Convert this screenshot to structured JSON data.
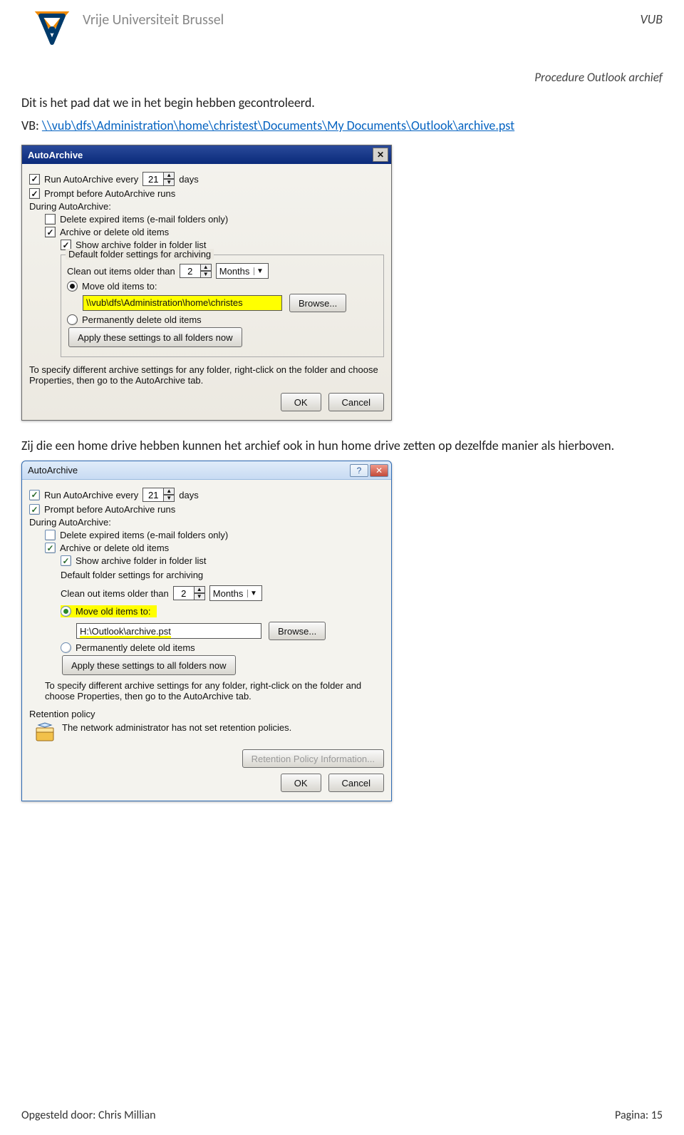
{
  "header": {
    "university": "Vrije Universiteit Brussel",
    "vub": "VUB",
    "subtitle": "Procedure Outlook archief"
  },
  "para1": "Dit is het pad dat we in het begin hebben gecontroleerd.",
  "vb_prefix": "VB: ",
  "vb_path": "\\\\vub\\dfs\\Administration\\home\\christest\\Documents\\My Documents\\Outlook\\archive.pst",
  "dlg1": {
    "title": "AutoArchive",
    "run_label": "Run AutoArchive every",
    "run_value": "21",
    "run_unit": "days",
    "prompt": "Prompt before AutoArchive runs",
    "during": "During AutoArchive:",
    "delete_expired": "Delete expired items (e-mail folders only)",
    "archive_old": "Archive or delete old items",
    "show_folder": "Show archive folder in folder list",
    "fieldset_legend": "Default folder settings for archiving",
    "clean_label": "Clean out items older than",
    "clean_value": "2",
    "clean_unit": "Months",
    "move_label": "Move old items to:",
    "move_path": "\\\\vub\\dfs\\Administration\\home\\christes",
    "browse": "Browse...",
    "perm_delete": "Permanently delete old items",
    "apply_all": "Apply these settings to all folders now",
    "info": "To specify different archive settings for any folder, right-click on the folder and choose Properties, then go to the AutoArchive tab.",
    "ok": "OK",
    "cancel": "Cancel"
  },
  "para2": "Zij die een home drive hebben kunnen het archief ook in hun home drive zetten op dezelfde manier als hierboven.",
  "dlg2": {
    "title": "AutoArchive",
    "run_label": "Run AutoArchive every",
    "run_value": "21",
    "run_unit": "days",
    "prompt": "Prompt before AutoArchive runs",
    "during": "During AutoArchive:",
    "delete_expired": "Delete expired items (e-mail folders only)",
    "archive_old": "Archive or delete old items",
    "show_folder": "Show archive folder in folder list",
    "fieldset_legend": "Default folder settings for archiving",
    "clean_label": "Clean out items older than",
    "clean_value": "2",
    "clean_unit": "Months",
    "move_label": "Move old items to:",
    "move_path": "H:\\Outlook\\archive.pst",
    "browse": "Browse...",
    "perm_delete": "Permanently delete old items",
    "apply_all": "Apply these settings to all folders now",
    "info": "To specify different archive settings for any folder, right-click on the folder and choose Properties, then go to the AutoArchive tab.",
    "retention_legend": "Retention policy",
    "retention_text": "The network administrator has not set retention policies.",
    "retention_btn": "Retention Policy Information...",
    "ok": "OK",
    "cancel": "Cancel"
  },
  "footer": {
    "author_label": "Opgesteld door: Chris Millian",
    "page_label": "Pagina: 15"
  }
}
